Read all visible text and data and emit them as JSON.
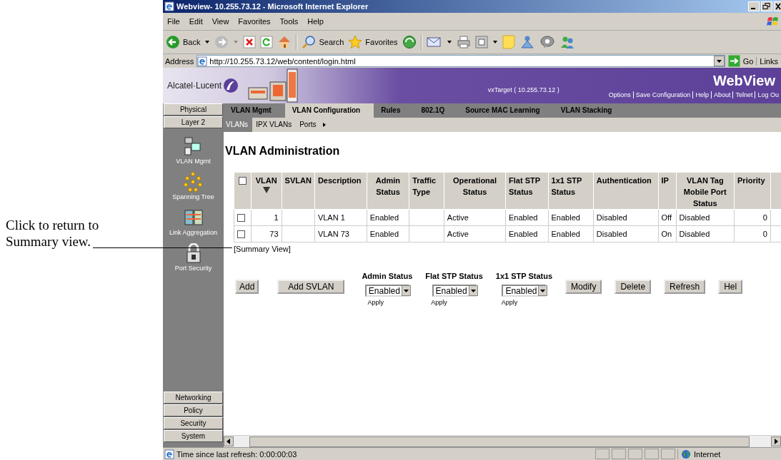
{
  "callout": {
    "text": "Click to return to Summary view."
  },
  "window": {
    "title": "Webview- 10.255.73.12 - Microsoft Internet Explorer"
  },
  "menu": [
    "File",
    "Edit",
    "View",
    "Favorites",
    "Tools",
    "Help"
  ],
  "toolbar": {
    "back": "Back",
    "search": "Search",
    "favorites": "Favorites"
  },
  "address": {
    "label": "Address",
    "url": "http://10.255.73.12/web/content/login.html",
    "go": "Go",
    "links": "Links"
  },
  "banner": {
    "brand": "Alcatel·Lucent",
    "target": "vxTarget ( 10.255.73.12 )",
    "product": "WebView",
    "links": [
      "Options",
      "Save Configuration",
      "Help",
      "About",
      "Telnet",
      "Log Ou"
    ]
  },
  "nav": {
    "top": [
      "Physical",
      "Layer 2"
    ],
    "items": [
      {
        "kind": "vlan",
        "label": "VLAN Mgmt"
      },
      {
        "kind": "tree",
        "label": "Spanning Tree"
      },
      {
        "kind": "link",
        "label": "Link Aggregation"
      },
      {
        "kind": "lock",
        "label": "Port Security"
      }
    ],
    "bottom": [
      "Networking",
      "Policy",
      "Security",
      "System"
    ]
  },
  "tabs": [
    {
      "label": "VLAN Mgmt",
      "selected": false
    },
    {
      "label": "VLAN Configuration",
      "selected": true
    },
    {
      "label": "Rules",
      "selected": false
    },
    {
      "label": "802.1Q",
      "selected": false
    },
    {
      "label": "Source MAC Learning",
      "selected": false
    },
    {
      "label": "VLAN Stacking",
      "selected": false
    }
  ],
  "subtabs": [
    {
      "label": "VLANs",
      "selected": true
    },
    {
      "label": "IPX VLANs",
      "selected": false
    },
    {
      "label": "Ports",
      "selected": false
    }
  ],
  "heading": "VLAN Administration",
  "table": {
    "columns": [
      "VLAN",
      "SVLAN",
      "Description",
      "Admin Status",
      "Traffic Type",
      "Operational Status",
      "Flat STP Status",
      "1x1 STP Status",
      "Authentication",
      "IP",
      "VLAN Tag Mobile Port Status",
      "Priority"
    ],
    "header_checked": false,
    "rows": [
      {
        "checked": false,
        "cells": [
          "1",
          "",
          "VLAN 1",
          "Enabled",
          "",
          "Active",
          "Enabled",
          "Enabled",
          "Disabled",
          "Off",
          "Disabled",
          "0"
        ]
      },
      {
        "checked": false,
        "cells": [
          "73",
          "",
          "VLAN 73",
          "Enabled",
          "",
          "Active",
          "Enabled",
          "Enabled",
          "Disabled",
          "On",
          "Disabled",
          "0"
        ]
      }
    ]
  },
  "summary_link": "[Summary View]",
  "controls": [
    {
      "kind": "button",
      "label": "Add"
    },
    {
      "kind": "button",
      "label": "Add SVLAN"
    },
    {
      "kind": "select",
      "label": "Admin Status",
      "value": "Enabled",
      "apply": "Apply"
    },
    {
      "kind": "select",
      "label": "Flat STP Status",
      "value": "Enabled",
      "apply": "Apply"
    },
    {
      "kind": "select",
      "label": "1x1 STP Status",
      "value": "Enabled",
      "apply": "Apply"
    },
    {
      "kind": "button",
      "label": "Modify"
    },
    {
      "kind": "button",
      "label": "Delete"
    },
    {
      "kind": "button",
      "label": "Refresh"
    },
    {
      "kind": "button",
      "label": "Hel"
    }
  ],
  "status_bar": {
    "text": "Time since last refresh: 0:00:00:03",
    "zone": "Internet"
  }
}
